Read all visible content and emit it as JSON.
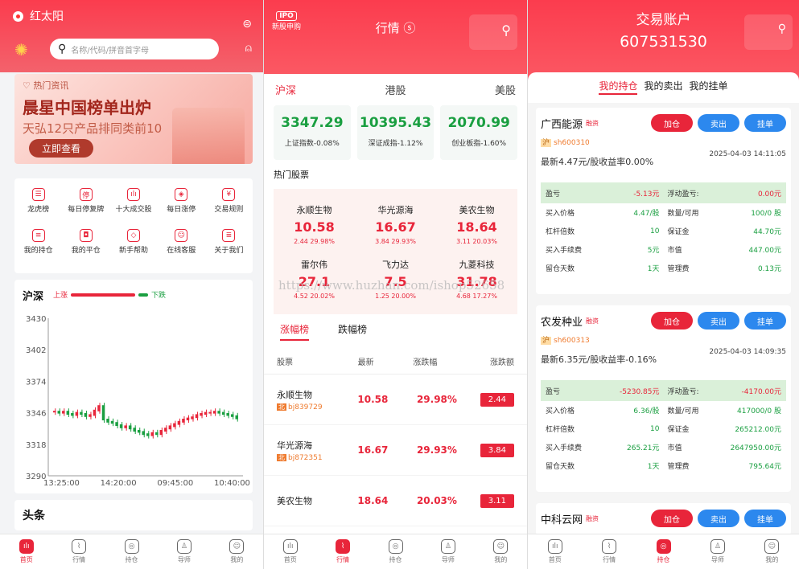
{
  "p1": {
    "brand": "红太阳",
    "search_placeholder": "名称/代码/拼音首字母",
    "banner": {
      "tag": "热门资讯",
      "headline": "晨星中国榜单出炉",
      "sub": "天弘12只产品排同类前10",
      "btn": "立即查看"
    },
    "grid": [
      {
        "g": "☰",
        "label": "龙虎榜"
      },
      {
        "g": "停",
        "label": "每日停复牌"
      },
      {
        "g": "ılı",
        "label": "十大成交股"
      },
      {
        "g": "◈",
        "label": "每日涨停"
      },
      {
        "g": "¥",
        "label": "交易规则"
      },
      {
        "g": "≡",
        "label": "我的持仓"
      },
      {
        "g": "◘",
        "label": "我的平仓"
      },
      {
        "g": "◇",
        "label": "新手帮助"
      },
      {
        "g": "☺",
        "label": "在线客服"
      },
      {
        "g": "≣",
        "label": "关于我们"
      }
    ],
    "chart": {
      "title": "沪深",
      "up": "上涨",
      "down": "下跌"
    },
    "toutiao": "头条"
  },
  "chart_data": {
    "type": "candlestick",
    "y_ticks": [
      3430,
      3402,
      3374,
      3346,
      3318,
      3290
    ],
    "x_ticks": [
      "13:25:00",
      "14:20:00",
      "09:45:00",
      "10:40:00"
    ],
    "ylim": [
      3290,
      3430
    ],
    "values": [
      3347,
      3346,
      3347,
      3345,
      3344,
      3346,
      3345,
      3343,
      3344,
      3348,
      3352,
      3340,
      3338,
      3337,
      3335,
      3333,
      3334,
      3332,
      3330,
      3329,
      3327,
      3326,
      3328,
      3327,
      3330,
      3332,
      3334,
      3336,
      3338,
      3340,
      3341,
      3342,
      3344,
      3345,
      3346,
      3346,
      3347,
      3346,
      3345,
      3344,
      3343,
      3341
    ]
  },
  "p2": {
    "ipo": "IPO",
    "ipo_label": "新股申购",
    "title": "行情 ⓢ",
    "tabs": [
      "沪深",
      "港股",
      "美股"
    ],
    "indices": [
      {
        "v": "3347.29",
        "l": "上证指数-0.08%"
      },
      {
        "v": "10395.43",
        "l": "深证成指-1.12%"
      },
      {
        "v": "2070.99",
        "l": "创业板指-1.60%"
      }
    ],
    "hot_title": "热门股票",
    "hot": [
      {
        "n": "永顺生物",
        "v": "10.58",
        "p": "2.44 29.98%"
      },
      {
        "n": "华光源海",
        "v": "16.67",
        "p": "3.84 29.93%"
      },
      {
        "n": "美农生物",
        "v": "18.64",
        "p": "3.11 20.03%"
      },
      {
        "n": "雷尔伟",
        "v": "27.1",
        "p": "4.52 20.02%"
      },
      {
        "n": "飞力达",
        "v": "7.5",
        "p": "1.25 20.00%"
      },
      {
        "n": "九菱科技",
        "v": "31.78",
        "p": "4.68 17.27%"
      }
    ],
    "watermark": "https://www.huzhan.com/ishop52658",
    "rtabs": [
      "涨幅榜",
      "跌幅榜"
    ],
    "thead": [
      "股票",
      "最新",
      "涨跌幅",
      "涨跌额"
    ],
    "rows": [
      {
        "n": "永顺生物",
        "m": "北",
        "c": "bj839729",
        "v": "10.58",
        "p": "29.98%",
        "d": "2.44"
      },
      {
        "n": "华光源海",
        "m": "北",
        "c": "bj872351",
        "v": "16.67",
        "p": "29.93%",
        "d": "3.84"
      },
      {
        "n": "美农生物",
        "m": "",
        "c": "",
        "v": "18.64",
        "p": "20.03%",
        "d": "3.11"
      }
    ]
  },
  "nav": [
    "首页",
    "行情",
    "持仓",
    "导师",
    "我的"
  ],
  "p3": {
    "title": "交易账户",
    "account": "607531530",
    "tabs": [
      "我的持仓",
      "我的卖出",
      "我的挂单"
    ],
    "btns": [
      "加仓",
      "卖出",
      "挂单"
    ],
    "rz": "融资",
    "cards": [
      {
        "name": "广西能源",
        "code": "sh600310",
        "newest": "最新4.47元/股收益率0.00%",
        "time": "2025-04-03 14:11:05",
        "pl": "-5.13元",
        "fl": "0.00元",
        "buy": "4.47/股",
        "qty": "100/0 股",
        "lev": "10",
        "margin": "44.70元",
        "fee": "5元",
        "mv": "447.00元",
        "days": "1天",
        "mgmt": "0.13元"
      },
      {
        "name": "农发种业",
        "code": "sh600313",
        "newest": "最新6.35元/股收益率-0.16%",
        "time": "2025-04-03 14:09:35",
        "pl": "-5230.85元",
        "fl": "-4170.00元",
        "buy": "6.36/股",
        "qty": "417000/0 股",
        "lev": "10",
        "margin": "265212.00元",
        "fee": "265.21元",
        "mv": "2647950.00元",
        "days": "1天",
        "mgmt": "795.64元"
      },
      {
        "name": "中科云网",
        "code": "",
        "newest": "",
        "time": ""
      }
    ],
    "labels": {
      "pl": "盈亏",
      "fl": "浮动盈亏:",
      "buy": "买入价格",
      "qty": "数量/可用",
      "lev": "杠杆倍数",
      "margin": "保证金",
      "fee": "买入手续费",
      "mv": "市值",
      "days": "留仓天数",
      "mgmt": "管理费"
    }
  }
}
